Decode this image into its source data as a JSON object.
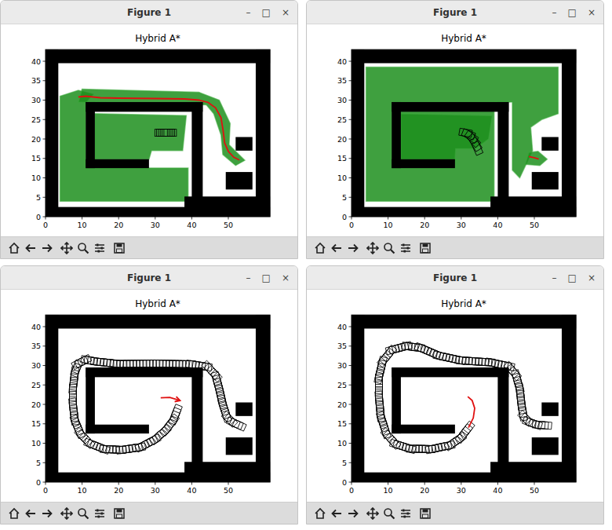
{
  "map": {
    "obstacles": [
      [
        0,
        0,
        3.5,
        43
      ],
      [
        57.5,
        0,
        61.4,
        43
      ],
      [
        0,
        39.5,
        61.4,
        43
      ],
      [
        0,
        0,
        61.4,
        2.5
      ],
      [
        38,
        0,
        61.4,
        5.2
      ],
      [
        40,
        5,
        43,
        29.5
      ],
      [
        11,
        27,
        43,
        29.5
      ],
      [
        11,
        12.5,
        13.5,
        29.5
      ],
      [
        11,
        12.5,
        28.3,
        14.8
      ],
      [
        52,
        17,
        56.6,
        20.5
      ],
      [
        49.3,
        7,
        56.6,
        11.5
      ]
    ]
  },
  "windows": [
    {
      "title": "Figure 1",
      "controls": [
        "–",
        "□",
        "×"
      ],
      "plot": {
        "title": "Hybrid A*",
        "x_ticks": [
          "0",
          "10",
          "20",
          "30",
          "40",
          "50"
        ],
        "y_ticks": [
          "0",
          "5",
          "10",
          "15",
          "20",
          "25",
          "30",
          "35",
          "40"
        ],
        "explored": [
          [
            [
              4,
              4
            ],
            [
              39,
              4
            ],
            [
              39,
              12.5
            ],
            [
              11,
              12.5
            ],
            [
              11,
              29.5
            ],
            [
              13,
              31.5
            ],
            [
              9,
              32.5
            ],
            [
              4,
              31
            ]
          ],
          [
            [
              13.5,
              14.8
            ],
            [
              28.3,
              14.8
            ],
            [
              29,
              17
            ],
            [
              37.5,
              17
            ],
            [
              38.5,
              26
            ],
            [
              13.5,
              26.5
            ]
          ],
          [
            [
              9,
              29.5
            ],
            [
              44,
              28.8
            ],
            [
              46,
              26.5
            ],
            [
              48,
              21
            ],
            [
              48.5,
              16
            ],
            [
              52,
              13.2
            ],
            [
              54.5,
              14.5
            ],
            [
              52,
              16.8
            ],
            [
              50.2,
              18.5
            ],
            [
              50.5,
              24
            ],
            [
              47.5,
              30
            ],
            [
              42,
              32
            ],
            [
              10,
              32.8
            ]
          ]
        ],
        "path": [
          [
            9,
            30.8
          ],
          [
            11,
            31
          ],
          [
            15,
            30.6
          ],
          [
            20,
            30.5
          ],
          [
            30,
            30.4
          ],
          [
            38,
            30.3
          ],
          [
            42,
            30
          ],
          [
            44.5,
            29.4
          ],
          [
            46.5,
            28
          ],
          [
            48,
            25.5
          ],
          [
            48.6,
            22
          ],
          [
            49,
            19
          ],
          [
            50,
            16.8
          ],
          [
            51.5,
            15.3
          ],
          [
            53,
            14.6
          ]
        ],
        "trail": [],
        "footprints": [
          [
            31.6,
            21.6,
            0
          ],
          [
            32.1,
            21.6,
            0
          ],
          [
            32.6,
            21.6,
            0
          ],
          [
            33.1,
            21.6,
            0
          ],
          [
            33.6,
            21.6,
            0
          ],
          [
            34.1,
            21.6,
            0
          ]
        ],
        "arrow": false
      }
    },
    {
      "title": "Figure 1",
      "controls": [
        "–",
        "□",
        "×"
      ],
      "plot": {
        "title": "Hybrid A*",
        "x_ticks": [
          "0",
          "10",
          "20",
          "30",
          "40",
          "50"
        ],
        "y_ticks": [
          "0",
          "5",
          "10",
          "15",
          "20",
          "25",
          "30",
          "35",
          "40"
        ],
        "explored": [
          [
            [
              4,
              4
            ],
            [
              39,
              4
            ],
            [
              39,
              29.5
            ],
            [
              44,
              29.5
            ],
            [
              44,
              12
            ],
            [
              46,
              10
            ],
            [
              47.5,
              13
            ],
            [
              49.5,
              17
            ],
            [
              49,
              23
            ],
            [
              52,
              25
            ],
            [
              56.5,
              26.5
            ],
            [
              56.5,
              38.5
            ],
            [
              4,
              38.5
            ]
          ],
          [
            [
              13.5,
              14.8
            ],
            [
              28.3,
              14.8
            ],
            [
              28.5,
              17.5
            ],
            [
              34,
              17.5
            ],
            [
              37.5,
              20
            ],
            [
              38.5,
              26
            ],
            [
              13.5,
              26.5
            ]
          ],
          [
            [
              47.5,
              13.5
            ],
            [
              51.5,
              13.2
            ],
            [
              53.5,
              14.8
            ],
            [
              51,
              16.8
            ],
            [
              48.5,
              16.5
            ]
          ]
        ],
        "path": [
          [
            48.5,
            15.5
          ],
          [
            50,
            15.2
          ],
          [
            51.2,
            14.8
          ]
        ],
        "trail": [],
        "footprints": [
          [
            31.2,
            21.6,
            -10
          ],
          [
            32,
            21.2,
            -22
          ],
          [
            32.8,
            20.5,
            -35
          ],
          [
            33.5,
            19.6,
            -48
          ],
          [
            34,
            18.6,
            -58
          ],
          [
            34.4,
            17.6,
            -66
          ]
        ],
        "arrow": false
      }
    },
    {
      "title": "Figure 1",
      "controls": [
        "–",
        "□",
        "×"
      ],
      "plot": {
        "title": "Hybrid A*",
        "x_ticks": [
          "0",
          "10",
          "20",
          "30",
          "40",
          "50"
        ],
        "y_ticks": [
          "0",
          "5",
          "10",
          "15",
          "20",
          "25",
          "30",
          "35",
          "40"
        ],
        "explored": [],
        "path": [
          [
            31.5,
            21.7
          ],
          [
            34,
            21.8
          ],
          [
            36.8,
            21
          ]
        ],
        "trail": [
          [
            53,
            14.6
          ],
          [
            51,
            15.5
          ],
          [
            49.5,
            17
          ],
          [
            48.5,
            20
          ],
          [
            47.5,
            24
          ],
          [
            46.5,
            27.5
          ],
          [
            44.5,
            29.6
          ],
          [
            40,
            30.3
          ],
          [
            30,
            30.5
          ],
          [
            20,
            30.4
          ],
          [
            14,
            31
          ],
          [
            11,
            31.5
          ],
          [
            9,
            30.5
          ],
          [
            8,
            28
          ],
          [
            7.5,
            24
          ],
          [
            7.5,
            20
          ],
          [
            8,
            16
          ],
          [
            9.5,
            12.5
          ],
          [
            12,
            10
          ],
          [
            16,
            8.5
          ],
          [
            21,
            8.3
          ],
          [
            26,
            9
          ],
          [
            30,
            11
          ],
          [
            33,
            13.5
          ],
          [
            35,
            16
          ],
          [
            36,
            18.5
          ]
        ],
        "footprints": [],
        "arrow": true
      }
    },
    {
      "title": "Figure 1",
      "controls": [
        "–",
        "□",
        "×"
      ],
      "plot": {
        "title": "Hybrid A*",
        "x_ticks": [
          "0",
          "10",
          "20",
          "30",
          "40",
          "50"
        ],
        "y_ticks": [
          "0",
          "5",
          "10",
          "15",
          "20",
          "25",
          "30",
          "35",
          "40"
        ],
        "explored": [],
        "path": [
          [
            32,
            14
          ],
          [
            33.3,
            16.5
          ],
          [
            33.7,
            19
          ],
          [
            33,
            21
          ],
          [
            31.8,
            22
          ]
        ],
        "trail": [
          [
            53,
            14.6
          ],
          [
            50.5,
            14.8
          ],
          [
            48.5,
            15.5
          ],
          [
            47,
            17
          ],
          [
            46.5,
            20
          ],
          [
            46,
            24
          ],
          [
            45,
            27.5
          ],
          [
            43,
            29.8
          ],
          [
            38,
            30.8
          ],
          [
            30,
            31.3
          ],
          [
            24,
            32.5
          ],
          [
            19,
            34.5
          ],
          [
            15,
            35
          ],
          [
            11,
            34
          ],
          [
            8.5,
            31
          ],
          [
            7.5,
            27
          ],
          [
            7.5,
            22
          ],
          [
            8,
            17
          ],
          [
            9.5,
            12.5
          ],
          [
            12,
            9.8
          ],
          [
            16,
            8.6
          ],
          [
            22,
            8.5
          ],
          [
            27,
            9.5
          ],
          [
            30,
            11.5
          ],
          [
            32,
            14
          ]
        ],
        "footprints": [],
        "arrow": false
      }
    }
  ]
}
